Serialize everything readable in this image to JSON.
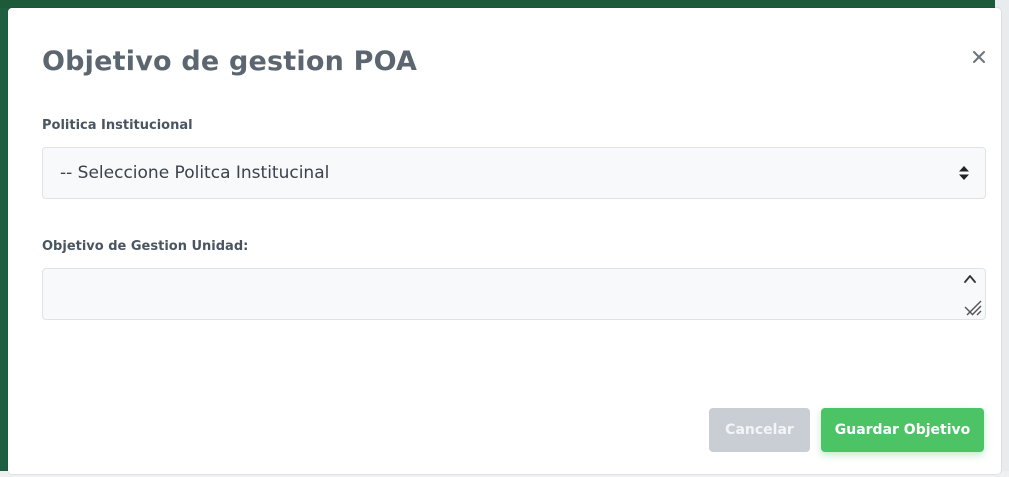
{
  "modal": {
    "title": "Objetivo de gestion POA",
    "close_symbol": "×",
    "fields": {
      "politica": {
        "label": "Politica Institucional",
        "selected_value": "-- Seleccione Politca Institucinal"
      },
      "objetivo": {
        "label": "Objetivo de Gestion Unidad:",
        "value": ""
      }
    },
    "buttons": {
      "cancel_label": "Cancelar",
      "save_label": "Guardar Objetivo"
    }
  },
  "colors": {
    "title": "#5c6670",
    "save_button": "#4cc466",
    "cancel_button": "#c9ced4",
    "backdrop": "#1f5f3f"
  },
  "icons": {
    "close": "close-icon",
    "select_arrows": "sort-arrows-icon",
    "textarea_scroll": "chevron-up-icon",
    "textarea_resize": "resize-grip-icon"
  }
}
